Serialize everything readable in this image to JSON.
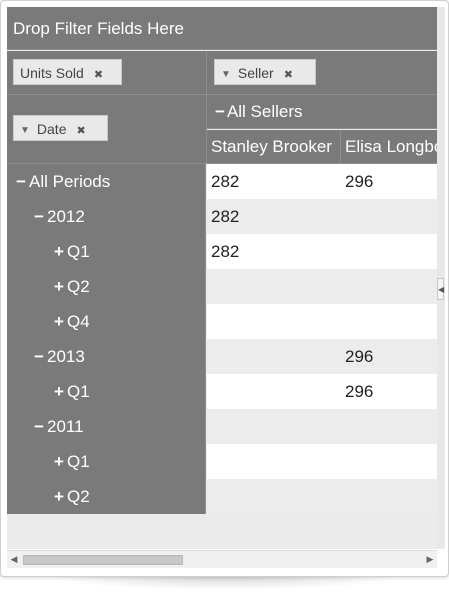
{
  "filter_zone": {
    "placeholder": "Drop Filter Fields Here"
  },
  "data_fields": [
    {
      "label": "Units Sold",
      "remove_icon": "close-icon"
    }
  ],
  "column_fields": [
    {
      "label": "Seller",
      "icon": "sort-caret-icon",
      "remove_icon": "close-icon"
    }
  ],
  "row_fields": [
    {
      "label": "Date",
      "icon": "sort-caret-icon",
      "remove_icon": "close-icon"
    }
  ],
  "column_header": {
    "group_label": "All Sellers",
    "group_sign": "−",
    "columns": [
      "Stanley Brooker",
      "Elisa Longbottom"
    ]
  },
  "rows": [
    {
      "label": "All Periods",
      "sign": "−",
      "level": 0,
      "values": [
        "282",
        "296"
      ]
    },
    {
      "label": "2012",
      "sign": "−",
      "level": 1,
      "values": [
        "282",
        ""
      ]
    },
    {
      "label": "Q1",
      "sign": "+",
      "level": 2,
      "values": [
        "282",
        ""
      ]
    },
    {
      "label": "Q2",
      "sign": "+",
      "level": 2,
      "values": [
        "",
        ""
      ]
    },
    {
      "label": "Q4",
      "sign": "+",
      "level": 2,
      "values": [
        "",
        ""
      ]
    },
    {
      "label": "2013",
      "sign": "−",
      "level": 1,
      "values": [
        "",
        "296"
      ]
    },
    {
      "label": "Q1",
      "sign": "+",
      "level": 2,
      "values": [
        "",
        "296"
      ]
    },
    {
      "label": "2011",
      "sign": "−",
      "level": 1,
      "values": [
        "",
        ""
      ]
    },
    {
      "label": "Q1",
      "sign": "+",
      "level": 2,
      "values": [
        "",
        ""
      ]
    },
    {
      "label": "Q2",
      "sign": "+",
      "level": 2,
      "values": [
        "",
        ""
      ]
    }
  ],
  "colors": {
    "header_bg": "#7a7a7a",
    "row_alt_bg": "#ececec",
    "chip_bg": "#e9e9e9"
  }
}
